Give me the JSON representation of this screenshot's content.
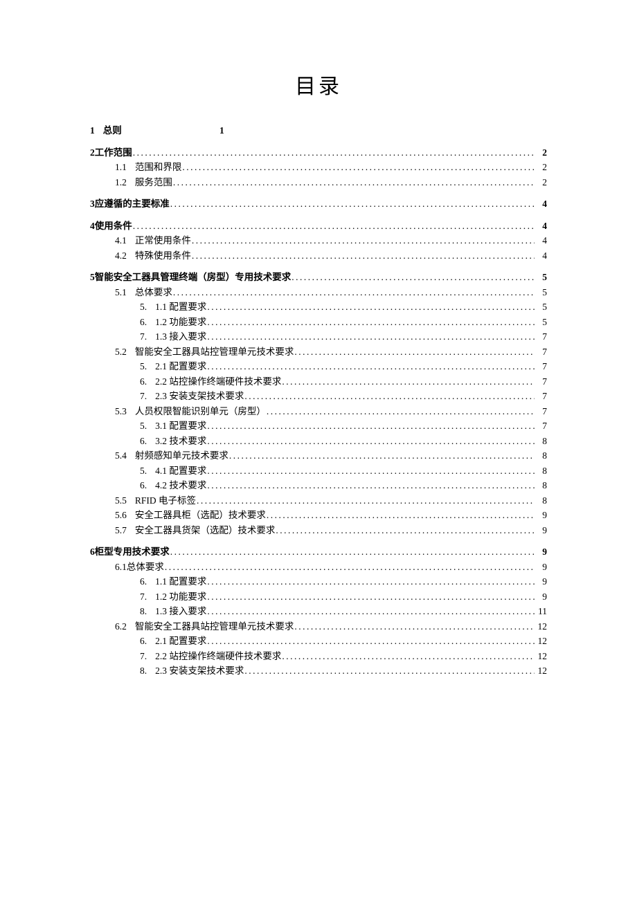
{
  "title": "目录",
  "items": [
    {
      "level": 1,
      "num": "1",
      "txt": "总则",
      "page": "1",
      "leader": false,
      "num_space": true,
      "first": true
    },
    {
      "level": 1,
      "num": "2",
      "txt": "工作范围",
      "page": "2",
      "leader": true
    },
    {
      "level": 2,
      "num": "1.1",
      "txt": "范围和界限",
      "page": "2",
      "leader": true,
      "num_space": true
    },
    {
      "level": 2,
      "num": "1.2",
      "txt": "服务范围",
      "page": "2",
      "leader": true,
      "num_space": true
    },
    {
      "level": 1,
      "num": "3",
      "txt": "应遵循的主要标准",
      "page": "4",
      "leader": true
    },
    {
      "level": 1,
      "num": "4",
      "txt": "使用条件",
      "page": "4",
      "leader": true
    },
    {
      "level": 2,
      "num": "4.1",
      "txt": "正常使用条件",
      "page": "4",
      "leader": true,
      "num_space": true
    },
    {
      "level": 2,
      "num": "4.2",
      "txt": "特殊使用条件",
      "page": "4",
      "leader": true,
      "num_space": true
    },
    {
      "level": 1,
      "num": "5",
      "txt": "智能安全工器具管理终端（房型）专用技术要求",
      "page": "5",
      "leader": true
    },
    {
      "level": 2,
      "num": "5.1",
      "txt": "总体要求",
      "page": "5",
      "leader": true,
      "num_space": true
    },
    {
      "level": 3,
      "num": "5.",
      "txt": "1.1 配置要求 ",
      "page": "5",
      "leader": true,
      "num_space": true
    },
    {
      "level": 3,
      "num": "6.",
      "txt": "1.2 功能要求 ",
      "page": "5",
      "leader": true,
      "num_space": true
    },
    {
      "level": 3,
      "num": "7.",
      "txt": "1.3 接入要求 ",
      "page": "7",
      "leader": true,
      "num_space": true
    },
    {
      "level": 2,
      "num": "5.2",
      "txt": "智能安全工器具站控管理单元技术要求",
      "page": "7",
      "leader": true,
      "num_space": true
    },
    {
      "level": 3,
      "num": "5.",
      "txt": "2.1 配置要求 ",
      "page": "7",
      "leader": true,
      "num_space": true
    },
    {
      "level": 3,
      "num": "6.",
      "txt": "2.2 站控操作终端硬件技术要求 ",
      "page": "7",
      "leader": true,
      "num_space": true
    },
    {
      "level": 3,
      "num": "7.",
      "txt": "2.3 安装支架技术要求 ",
      "page": "7",
      "leader": true,
      "num_space": true
    },
    {
      "level": 2,
      "num": "5.3",
      "txt": "人员权限智能识别单元（房型）",
      "page": "7",
      "leader": true,
      "num_space": true
    },
    {
      "level": 3,
      "num": "5.",
      "txt": "3.1 配置要求 ",
      "page": "7",
      "leader": true,
      "num_space": true
    },
    {
      "level": 3,
      "num": "6.",
      "txt": "3.2 技术要求 ",
      "page": "8",
      "leader": true,
      "num_space": true
    },
    {
      "level": 2,
      "num": "5.4",
      "txt": "射频感知单元技术要求",
      "page": "8",
      "leader": true,
      "num_space": true
    },
    {
      "level": 3,
      "num": "5.",
      "txt": "4.1 配置要求 ",
      "page": "8",
      "leader": true,
      "num_space": true
    },
    {
      "level": 3,
      "num": "6.",
      "txt": "4.2 技术要求 ",
      "page": "8",
      "leader": true,
      "num_space": true
    },
    {
      "level": 2,
      "num": "5.5",
      "txt": "RFID 电子标签 ",
      "page": "8",
      "leader": true,
      "num_space": true
    },
    {
      "level": 2,
      "num": "5.6",
      "txt": "安全工器具柜（选配）技术要求",
      "page": "9",
      "leader": true,
      "num_space": true
    },
    {
      "level": 2,
      "num": "5.7",
      "txt": "安全工器具货架（选配）技术要求",
      "page": "9",
      "leader": true,
      "num_space": true
    },
    {
      "level": 1,
      "num": "6",
      "txt": "柜型专用技术要求",
      "page": "9",
      "leader": true
    },
    {
      "level": 2,
      "num": "6.1",
      "txt": "总体要求",
      "page": "9",
      "leader": true
    },
    {
      "level": 3,
      "num": "6.",
      "txt": "1.1 配置要求 ",
      "page": "9",
      "leader": true,
      "num_space": true
    },
    {
      "level": 3,
      "num": "7.",
      "txt": "1.2 功能要求 ",
      "page": "9",
      "leader": true,
      "num_space": true
    },
    {
      "level": 3,
      "num": "8.",
      "txt": "1.3 接入要求 ",
      "page": "11",
      "leader": true,
      "num_space": true
    },
    {
      "level": 2,
      "num": "6.2",
      "txt": "智能安全工器具站控管理单元技术要求",
      "page": "12",
      "leader": true,
      "num_space": true
    },
    {
      "level": 3,
      "num": "6.",
      "txt": "2.1 配置要求 ",
      "page": "12",
      "leader": true,
      "num_space": true
    },
    {
      "level": 3,
      "num": "7.",
      "txt": "2.2 站控操作终端硬件技术要求 ",
      "page": "12",
      "leader": true,
      "num_space": true
    },
    {
      "level": 3,
      "num": "8.",
      "txt": "2.3 安装支架技术要求 ",
      "page": "12",
      "leader": true,
      "num_space": true
    }
  ]
}
